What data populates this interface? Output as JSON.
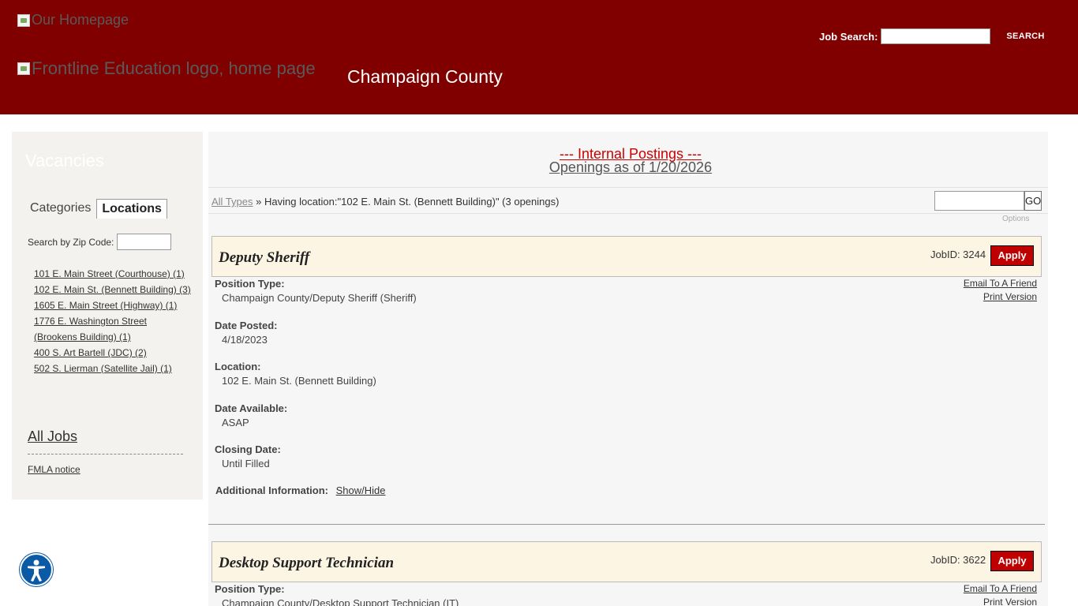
{
  "header": {
    "home_link": "Our Homepage",
    "logo_alt": "Frontline Education logo, home page",
    "org_name": "Champaign County",
    "job_search_label": "Job Search:",
    "search_button": "SEARCH"
  },
  "sidebar": {
    "title": "Vacancies",
    "tabs": [
      "Categories",
      "Locations"
    ],
    "zip_label": "Search by Zip Code:",
    "locations": [
      "101 E. Main Street (Courthouse) (1)",
      "102 E. Main St. (Bennett Building) (3)",
      "1605 E. Main Street (Highway) (1)",
      "1776 E. Washington Street (Brookens Building) (1)",
      "400 S. Art Bartell (JDC) (2)",
      "502 S. Lierman (Satellite Jail) (1)"
    ],
    "all_jobs": "All Jobs",
    "fmla": "FMLA notice"
  },
  "main": {
    "postings_title": "--- Internal Postings ---",
    "openings_title": "Openings as of 1/20/2026",
    "crumb_link": "All Types",
    "crumb_text": "Having location:\"102 E. Main St. (Bennett Building)\" (3 openings)",
    "crumb_sep": "»",
    "go_button": "GO",
    "options": "Options",
    "jobs": [
      {
        "title": "Deputy Sheriff",
        "jobid": "JobID: 3244",
        "apply": "Apply",
        "email": "Email To A Friend",
        "print": "Print Version",
        "position_type_label": "Position Type:",
        "position_type": "Champaign County/Deputy Sheriff (Sheriff)",
        "date_posted_label": "Date Posted:",
        "date_posted": "4/18/2023",
        "location_label": "Location:",
        "location": "102 E. Main St. (Bennett Building)",
        "date_available_label": "Date Available:",
        "date_available": "ASAP",
        "closing_date_label": "Closing Date:",
        "closing_date": "Until Filled",
        "additional_label": "Additional Information:",
        "show_hide": "Show/Hide"
      },
      {
        "title": "Desktop Support Technician",
        "jobid": "JobID: 3622",
        "apply": "Apply",
        "email": "Email To A Friend",
        "print": "Print Version",
        "position_type_label": "Position Type:",
        "position_type": "Champaign County/Desktop Support Technician (IT)"
      }
    ]
  },
  "colors": {
    "header_bg": "#800000",
    "apply_bg": "#c00000",
    "job_header_bg": "#fdf5e4",
    "postings_red": "#cc0000"
  },
  "icons": {
    "accessibility": "accessibility-icon",
    "broken_image": "broken-image-icon"
  }
}
